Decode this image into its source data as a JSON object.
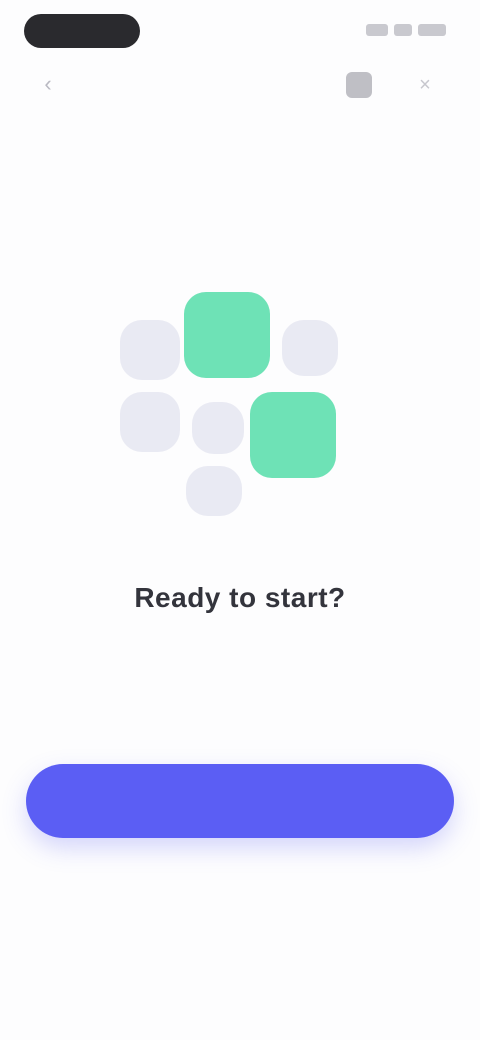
{
  "status_bar": {
    "time": "",
    "icons": [
      "signal-icon",
      "wifi-icon",
      "battery-icon"
    ]
  },
  "toolbar": {
    "back_icon": "back-arrow-icon",
    "action_icons": [
      "theme-icon",
      "close-icon"
    ]
  },
  "illustration": {
    "tiles": [
      "grey",
      "green",
      "grey",
      "grey",
      "grey",
      "green",
      "grey"
    ],
    "colors": {
      "green": "#6ee2b6",
      "grey": "#e9eaf3"
    }
  },
  "content": {
    "title": "Ready to start?",
    "description": ""
  },
  "primary_button": {
    "label": "",
    "color": "#5b5ef4"
  }
}
